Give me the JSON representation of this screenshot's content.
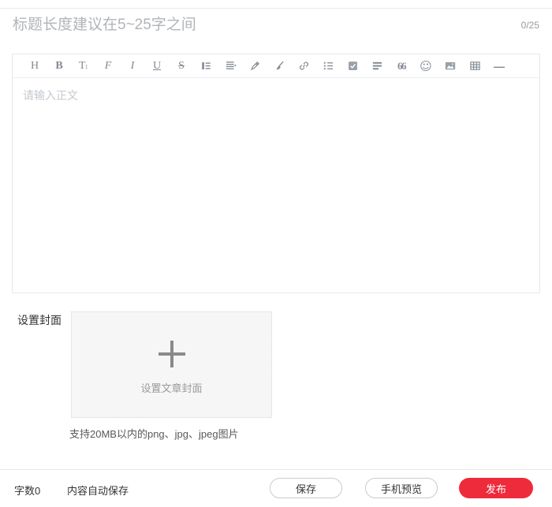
{
  "title_bar": {
    "placeholder": "标题长度建议在5~25字之间",
    "counter": "0/25"
  },
  "toolbar": {
    "icons": [
      {
        "name": "heading-icon",
        "kind": "text",
        "glyph": "H",
        "cls": "serif"
      },
      {
        "name": "bold-icon",
        "kind": "text",
        "glyph": "B",
        "cls": "serif bold"
      },
      {
        "name": "font-size-icon",
        "kind": "text",
        "glyph": "T",
        "suffix": "↕",
        "cls": "serif"
      },
      {
        "name": "font-family-icon",
        "kind": "text",
        "glyph": "F",
        "cls": "serif italic"
      },
      {
        "name": "italic-icon",
        "kind": "text",
        "glyph": "I",
        "cls": "serif italic"
      },
      {
        "name": "underline-icon",
        "kind": "text",
        "glyph": "U",
        "cls": "serif underline"
      },
      {
        "name": "strikethrough-icon",
        "kind": "text",
        "glyph": "S",
        "cls": "serif strike"
      },
      {
        "name": "indent-icon",
        "kind": "svg",
        "svg": "indent"
      },
      {
        "name": "line-height-icon",
        "kind": "svg",
        "svg": "lineheight"
      },
      {
        "name": "pen-icon",
        "kind": "svg",
        "svg": "pen"
      },
      {
        "name": "brush-icon",
        "kind": "svg",
        "svg": "brush"
      },
      {
        "name": "link-icon",
        "kind": "svg",
        "svg": "link"
      },
      {
        "name": "unordered-list-icon",
        "kind": "svg",
        "svg": "list"
      },
      {
        "name": "task-list-icon",
        "kind": "svg",
        "svg": "checkbox"
      },
      {
        "name": "align-icon",
        "kind": "svg",
        "svg": "align"
      },
      {
        "name": "quote-icon",
        "kind": "text",
        "glyph": "66",
        "cls": "serif bold quote"
      },
      {
        "name": "emoji-icon",
        "kind": "text",
        "glyph": "☺",
        "cls": "emoji"
      },
      {
        "name": "image-icon",
        "kind": "svg",
        "svg": "image"
      },
      {
        "name": "table-icon",
        "kind": "svg",
        "svg": "table"
      },
      {
        "name": "horizontal-rule-icon",
        "kind": "text",
        "glyph": "—",
        "cls": "bold dash"
      }
    ]
  },
  "editor": {
    "placeholder": "请输入正文"
  },
  "cover": {
    "label": "设置封面",
    "upload_text": "设置文章封面",
    "hint": "支持20MB以内的png、jpg、jpeg图片"
  },
  "footer": {
    "word_count_label": "字数",
    "word_count_value": "0",
    "autosave_text": "内容自动保存",
    "save_label": "保存",
    "preview_label": "手机预览",
    "publish_label": "发布"
  },
  "colors": {
    "accent_red": "#ee2b3b",
    "icon_gray": "#828a94",
    "title_placeholder_gray": "#b1b4b9",
    "body_placeholder_gray": "#c4c9d1"
  }
}
